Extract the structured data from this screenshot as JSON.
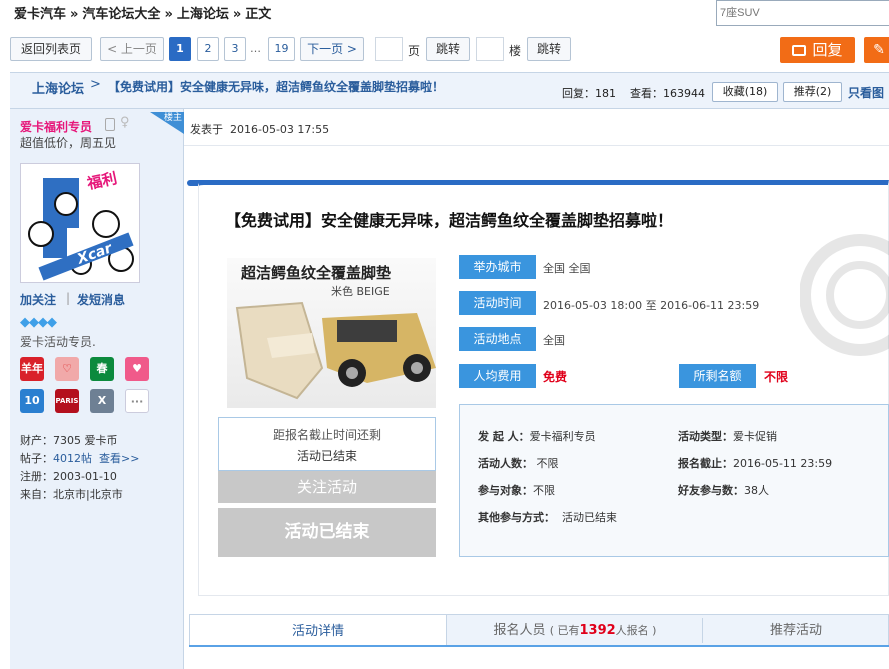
{
  "breadcrumb": [
    "爱卡汽车",
    "汽车论坛大全",
    "上海论坛",
    "正文"
  ],
  "breadcrumb_sep": "»",
  "search": {
    "placeholder": "7座SUV"
  },
  "pager": {
    "back_label": "返回列表页",
    "prev_label": "< 上一页",
    "pages": [
      "1",
      "2",
      "3"
    ],
    "ellipsis": "…",
    "last_page": "19",
    "next_label": "下一页 >",
    "page_unit": "页",
    "jump_label": "跳转",
    "floor_unit": "楼",
    "jump2_label": "跳转"
  },
  "actions": {
    "reply_label": "回复",
    "reply_icon": "speech-bubble-icon",
    "edit_icon": "pencil-icon"
  },
  "thread": {
    "forum": "上海论坛",
    "arrow": ">",
    "title": "【免费试用】安全健康无异味，超洁鳄鱼纹全覆盖脚垫招募啦！",
    "replies_label": "回复：",
    "replies": "181",
    "views_label": "查看：",
    "views": "163944",
    "fav_label": "收藏(18)",
    "rec_label": "推荐(2)",
    "only_lz": "只看图"
  },
  "user": {
    "name": "爱卡福利专员",
    "subtitle": "超值低价，周五见",
    "avatar_text": "福利",
    "avatar_brand": "Xcar",
    "follow_label": "加关注",
    "divider": "|",
    "message_label": "发短消息",
    "group": "爱卡活动专员.",
    "medals": [
      "羊年",
      "♡",
      "春",
      "♥",
      "10",
      "PARIS",
      "X",
      "···"
    ],
    "wealth_label": "财产：",
    "wealth": "7305 爱卡币",
    "posts_label": "帖子：",
    "posts": "4012帖",
    "view_label": "查看>>",
    "reg_label": "注册：",
    "reg": "2003-01-10",
    "from_label": "来自：",
    "from": "北京市|北京市"
  },
  "post": {
    "lz_badge": "楼主",
    "time_label": "发表于",
    "time": "2016-05-03 17:55"
  },
  "activity": {
    "title": "【免费试用】安全健康无异味，超洁鳄鱼纹全覆盖脚垫招募啦！",
    "img_title": "超洁鳄鱼纹全覆盖脚垫",
    "img_sub": "米色 BEIGE",
    "city_label": "举办城市",
    "city": "全国 全国",
    "time_label": "活动时间",
    "time": "2016-05-03 18:00 至 2016-06-11 23:59",
    "place_label": "活动地点",
    "place": "全国",
    "fee_label": "人均费用",
    "fee": "免费",
    "quota_label": "所剩名额",
    "quota": "不限",
    "deadline_label": "距报名截止时间还剩",
    "deadline_value": "活动已结束",
    "follow_btn": "关注活动",
    "end_btn": "活动已结束",
    "details": {
      "sponsor_label": "发 起 人：",
      "sponsor": "爱卡福利专员",
      "type_label": "活动类型：",
      "type": "爱卡促销",
      "people_label": "活动人数：",
      "people": "不限",
      "close_label": "报名截止：",
      "close": "2016-05-11 23:59",
      "target_label": "参与对象：",
      "target": "不限",
      "friends_label": "好友参与数：",
      "friends": "38人",
      "other_label": "其他参与方式：",
      "other": "活动已结束"
    }
  },
  "tabs": {
    "detail": "活动详情",
    "members_pre": "报名人员",
    "members_open": "( 已有",
    "members_count": "1392",
    "members_close": "人报名 )",
    "recommend": "推荐活动"
  },
  "colors": {
    "accent": "#2a6bc4",
    "orange": "#f26c16",
    "label_blue": "#3a95de",
    "red": "#e0001a"
  }
}
